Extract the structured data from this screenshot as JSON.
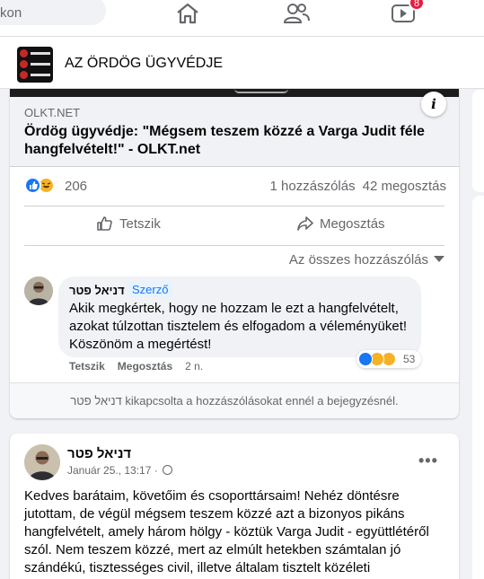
{
  "topnav": {
    "search_placeholder": "kon",
    "badge_count": "8"
  },
  "page": {
    "title": "AZ ÖRDÖG ÜGYVÉDJE"
  },
  "link_preview": {
    "domain": "OLKT.NET",
    "title": "Ördög ügyvédje: \"Mégsem teszem közzé a Varga Judit féle hangfelvételt!\" - OLKT.net",
    "info_label": "i"
  },
  "reactions": {
    "count": "206",
    "comments": "1 hozzászólás",
    "shares": "42 megosztás",
    "icons": [
      "like-icon",
      "haha-icon"
    ],
    "colors": {
      "like": "#1877f2",
      "haha": "#f7b125"
    }
  },
  "actions": {
    "like_label": "Tetszik",
    "share_label": "Megosztás"
  },
  "comments_filter": "Az összes hozzászólás",
  "comment": {
    "author": "דניאל פטר",
    "author_badge": "Szerző",
    "text": "Akik megkértek, hogy ne hozzam le ezt a hangfelvételt, azokat túlzottan tisztelem és elfogadom a véleményüket! Köszönöm a megértést!",
    "reaction_count": "53",
    "like_label": "Tetszik",
    "share_label": "Megosztás",
    "time": "2 n."
  },
  "comments_disabled": {
    "name": "דניאל פטר",
    "text": " kikapcsolta a hozzászólásokat ennél a bejegyzésnél."
  },
  "post": {
    "author": "דניאל פטר",
    "date": "Január 25., 13:17 ·",
    "more_label": "•••",
    "text": "Kedves barátaim, követőim és csoporttársaim! Nehéz döntésre jutottam, de végül mégsem teszem közzé azt a bizonyos pikáns hangfelvételt, amely három hölgy - köztük Varga Judit - együttlétéről szól. Nem teszem közzé, mert az elmúlt hetekben számtalan jó szándékú, tisztességes civil, illetve általam tisztelt közéleti"
  }
}
